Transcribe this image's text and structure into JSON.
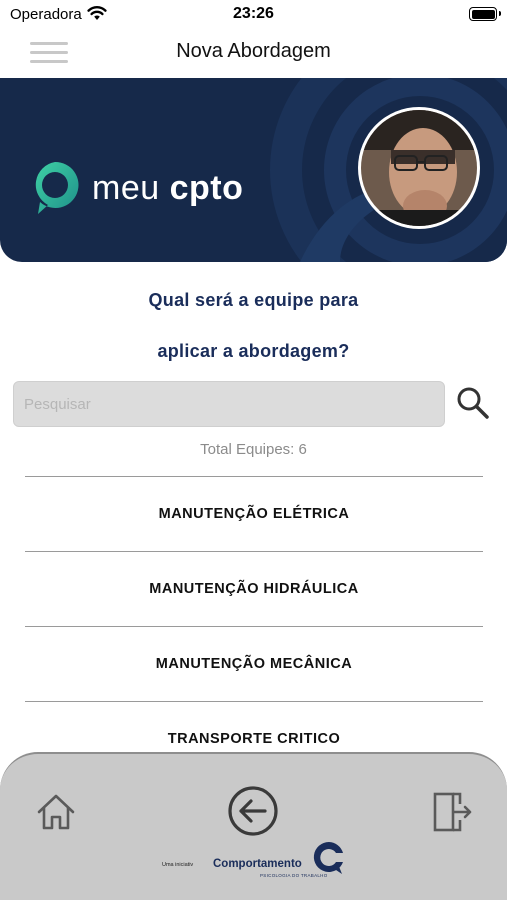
{
  "status_bar": {
    "carrier": "Operadora",
    "time": "23:26"
  },
  "nav": {
    "title": "Nova Abordagem"
  },
  "banner": {
    "logo_light": "meu ",
    "logo_bold": "cpto"
  },
  "question": {
    "line1": "Qual será a equipe para",
    "line2": "aplicar a abordagem?"
  },
  "search": {
    "placeholder": "Pesquisar",
    "value": ""
  },
  "total_label": "Total Equipes: 6",
  "teams": [
    "MANUTENÇÃO ELÉTRICA",
    "MANUTENÇÃO HIDRÁULICA",
    "MANUTENÇÃO MECÂNICA",
    "TRANSPORTE CRITICO"
  ],
  "footer": {
    "initiative": "Uma iniciativ",
    "brand": "Comportamento",
    "brand_sub": "PSICOLOGIA DO TRABALHO"
  },
  "colors": {
    "banner_bg": "#16294a",
    "accent_teal": "#2fbf9b",
    "question_text": "#1a2d5a",
    "bottom_bar": "#c9c9c9"
  },
  "icons": {
    "wifi": "wifi-icon",
    "battery": "battery-icon",
    "menu": "hamburger-menu-icon",
    "search": "search-icon",
    "home": "home-icon",
    "back": "arrow-left-circle-icon",
    "exit": "exit-door-icon"
  }
}
